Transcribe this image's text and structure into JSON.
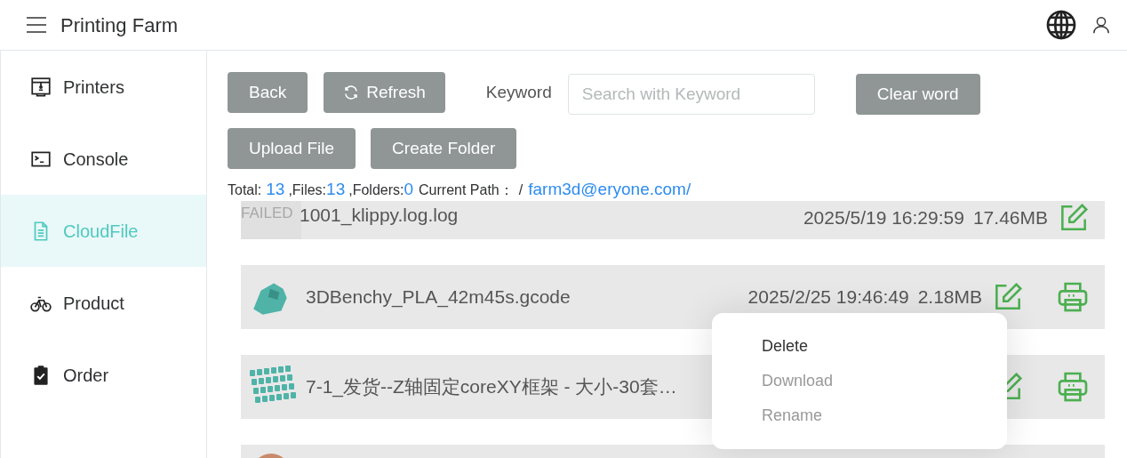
{
  "header": {
    "title": "Printing Farm"
  },
  "sidebar": {
    "items": [
      {
        "label": "Printers",
        "selected": false
      },
      {
        "label": "Console",
        "selected": false
      },
      {
        "label": "CloudFile",
        "selected": true
      },
      {
        "label": "Product",
        "selected": false
      },
      {
        "label": "Order",
        "selected": false
      }
    ]
  },
  "toolbar": {
    "back": "Back",
    "refresh": "Refresh",
    "keyword_label": "Keyword",
    "search": {
      "placeholder": "Search with Keyword"
    },
    "clear": "Clear word",
    "upload": "Upload File",
    "create_folder": "Create Folder"
  },
  "summary": {
    "total_label": "Total:",
    "total": "13",
    "files_label": ",Files:",
    "files": "13",
    "folders_label": ",Folders:",
    "folders": "0",
    "path_label": "Current Path：",
    "path_sep": "/",
    "path": "farm3d@eryone.com/"
  },
  "files": [
    {
      "kind": "failed",
      "thumb_label": "FAILED",
      "name": "1001_klippy.log.log",
      "date": "2025/5/19 16:29:59",
      "size": "17.46MB",
      "printable": false
    },
    {
      "kind": "model",
      "name": "3DBenchy_PLA_42m45s.gcode",
      "date": "2025/2/25 19:46:49",
      "size": "2.18MB",
      "printable": true
    },
    {
      "kind": "model",
      "name": "7-1_发货--Z轴固定coreXY框架 - 大小-30套…",
      "printable": true
    },
    {
      "kind": "partial"
    }
  ],
  "context_menu": {
    "items": [
      {
        "label": "Delete",
        "disabled": false
      },
      {
        "label": "Download",
        "disabled": true
      },
      {
        "label": "Rename",
        "disabled": true
      }
    ]
  }
}
